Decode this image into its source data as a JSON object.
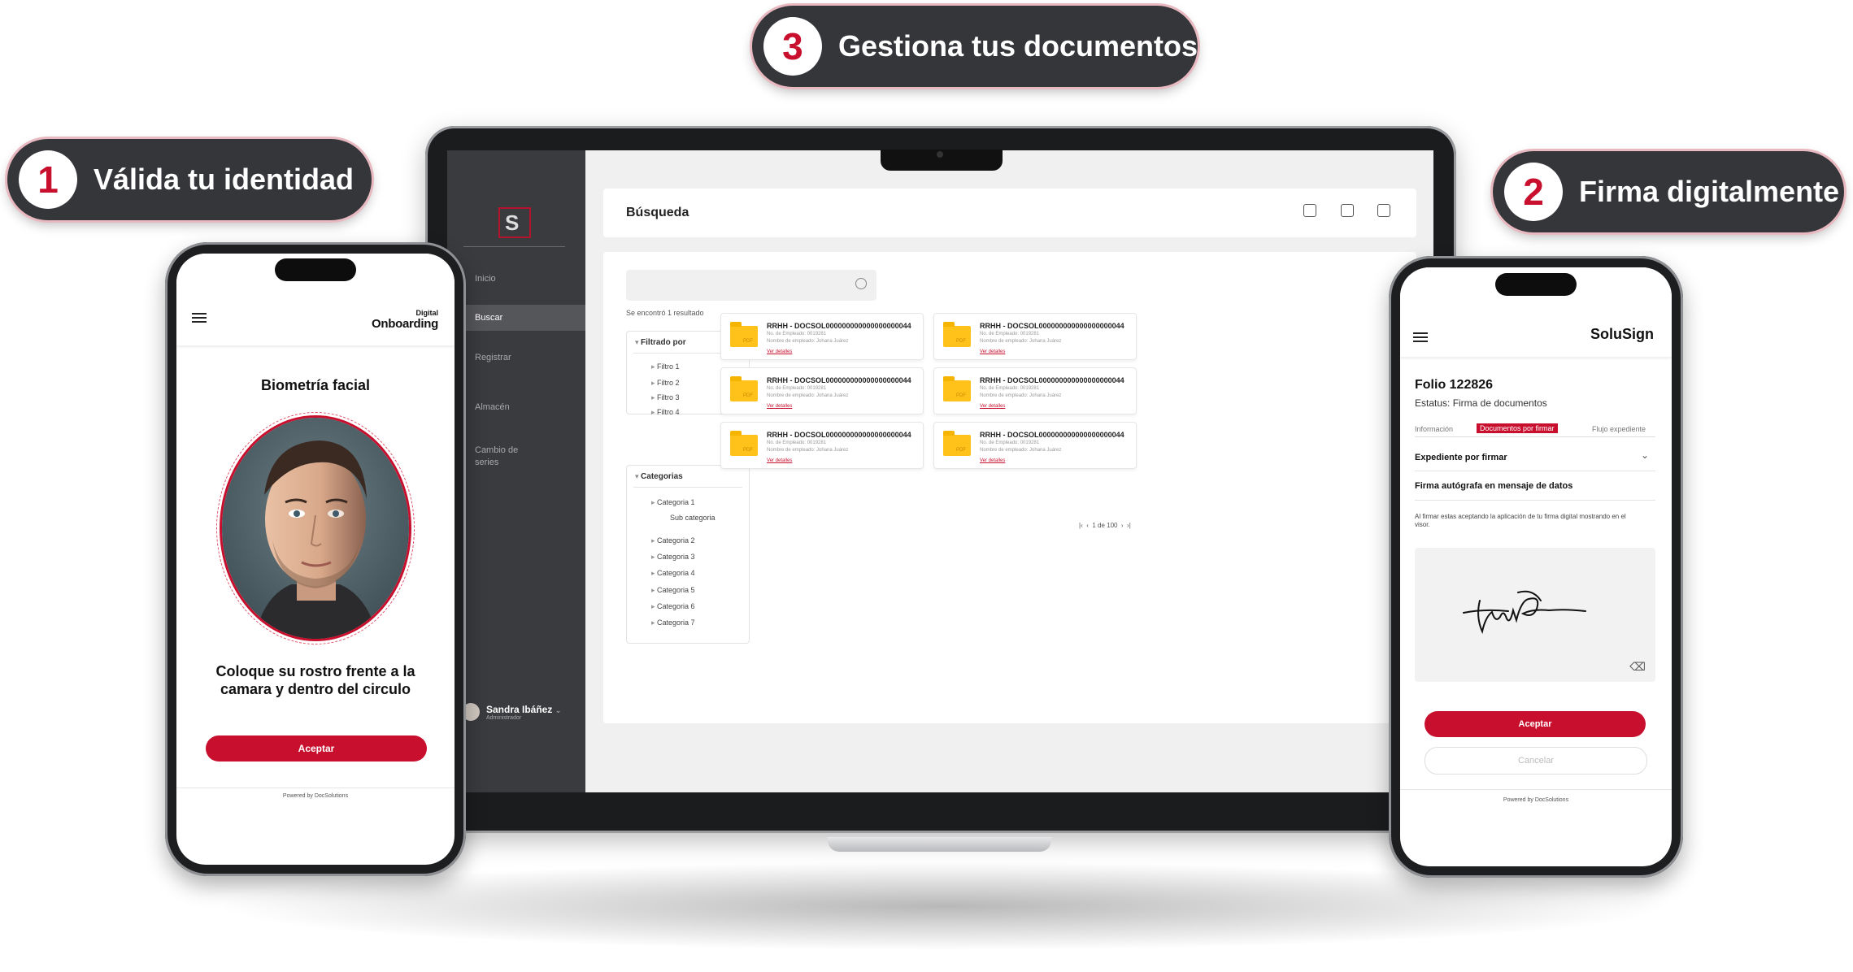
{
  "steps": [
    {
      "number": "3",
      "label": "Gestiona tus documentos"
    },
    {
      "number": "1",
      "label": "Válida tu identidad"
    },
    {
      "number": "2",
      "label": "Firma digitalmente"
    }
  ],
  "laptop": {
    "sidebar": {
      "items": [
        {
          "label": "Inicio",
          "icon": "home-icon"
        },
        {
          "label": "Buscar",
          "icon": "search-icon"
        },
        {
          "label": "Registrar",
          "icon": "register-icon"
        },
        {
          "label": "Almacén",
          "icon": "archive-icon"
        },
        {
          "label": "Cambio de series",
          "icon": "refresh-icon"
        }
      ],
      "active": "Buscar",
      "user_name": "Sandra Ibáñez",
      "user_role": "Administrador"
    },
    "header": {
      "title": "Búsqueda"
    },
    "search": {
      "placeholder": "",
      "result_text": "Se encontró 1 resultado"
    },
    "filters": {
      "title": "Filtrado por",
      "items": [
        "Filtro 1",
        "Filtro 2",
        "Filtro 3",
        "Filtro 4"
      ]
    },
    "categories": {
      "title": "Categorias",
      "items": [
        "Categoria 1",
        "Sub categoria",
        "Categoria 2",
        "Categoria 3",
        "Categoria 4",
        "Categoria 5",
        "Categoria 6",
        "Categoria 7"
      ]
    },
    "files": [
      {
        "title": "RRHH - DOCSOL000000000000000000044",
        "employee_no": "No. de Empleado: 0019281",
        "employee_name": "Nombre de empleado: Johana Juárez",
        "link": "Ver detalles"
      },
      {
        "title": "RRHH - DOCSOL000000000000000000044",
        "employee_no": "No. de Empleado: 0019281",
        "employee_name": "Nombre de empleado: Johana Juárez",
        "link": "Ver detalles"
      },
      {
        "title": "RRHH - DOCSOL000000000000000000044",
        "employee_no": "No. de Empleado: 0019281",
        "employee_name": "Nombre de empleado: Johana Juárez",
        "link": "Ver detalles"
      },
      {
        "title": "RRHH - DOCSOL000000000000000000044",
        "employee_no": "No. de Empleado: 0019281",
        "employee_name": "Nombre de empleado: Johana Juárez",
        "link": "Ver detalles"
      },
      {
        "title": "RRHH - DOCSOL000000000000000000044",
        "employee_no": "No. de Empleado: 0019281",
        "employee_name": "Nombre de empleado: Johana Juárez",
        "link": "Ver detalles"
      },
      {
        "title": "RRHH - DOCSOL000000000000000000044",
        "employee_no": "No. de Empleado: 0019281",
        "employee_name": "Nombre de empleado: Johana Juárez",
        "link": "Ver detalles"
      }
    ],
    "pagination": "1 de 100"
  },
  "phone_left": {
    "brand_top": "Digital",
    "brand_bottom": "Onboarding",
    "title": "Biometría facial",
    "instruction": "Coloque su rostro frente a la camara y dentro del circulo",
    "button": "Aceptar",
    "footer": "Powered by DocSolutions"
  },
  "phone_right": {
    "brand": "SoluSign",
    "folio": "Folio 122826",
    "status": "Estatus: Firma de documentos",
    "tabs": [
      "Información",
      "Documentos por firmar",
      "Flujo expediente"
    ],
    "active_tab": "Documentos por firmar",
    "section1": "Expediente por firmar",
    "section2": "Firma autógrafa en mensaje de datos",
    "notice": "Al firmar estas aceptando la aplicación de tu firma digital mostrando en el visor.",
    "accept": "Aceptar",
    "cancel": "Cancelar",
    "footer": "Powered by DocSolutions"
  },
  "colors": {
    "accent": "#c8102e",
    "dark": "#35363a",
    "folder": "#ffc21a"
  }
}
